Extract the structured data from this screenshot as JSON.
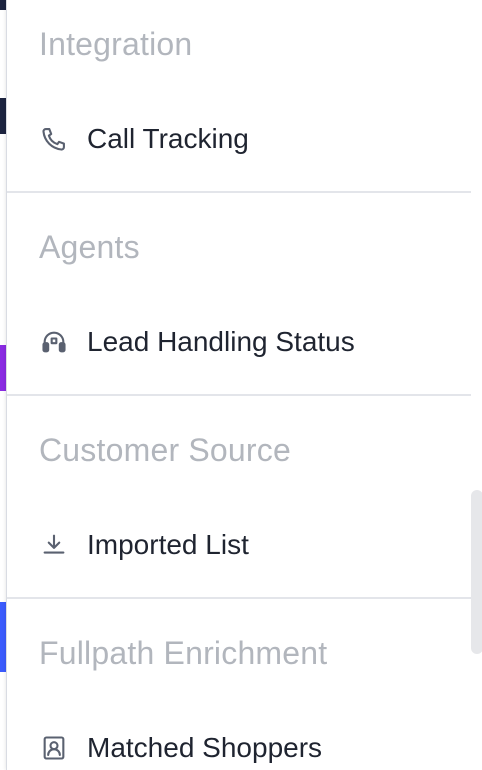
{
  "menu": {
    "sections": [
      {
        "title": "Integration",
        "item": {
          "label": "Call Tracking",
          "icon": "phone-icon"
        }
      },
      {
        "title": "Agents",
        "item": {
          "label": "Lead Handling Status",
          "icon": "headset-icon"
        }
      },
      {
        "title": "Customer Source",
        "item": {
          "label": "Imported List",
          "icon": "download-icon"
        }
      },
      {
        "title": "Fullpath Enrichment",
        "item": {
          "label": "Matched Shoppers",
          "icon": "person-badge-icon"
        }
      }
    ]
  },
  "colors": {
    "section_title": "#b2b6bd",
    "item_label": "#1f2430",
    "icon": "#5a6170",
    "divider": "#e3e5ea",
    "scrollbar": "#e6e7ea"
  }
}
